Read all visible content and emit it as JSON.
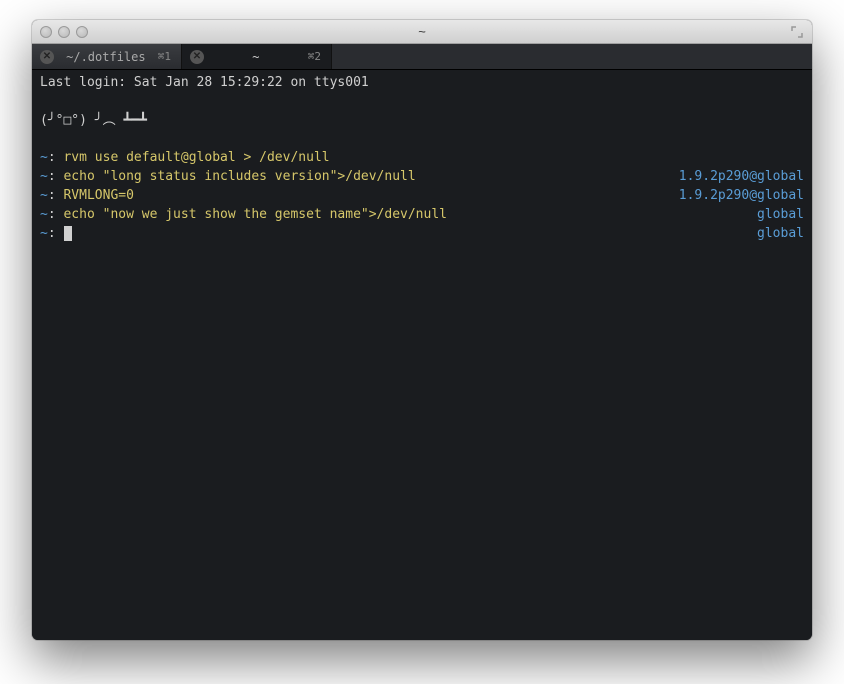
{
  "window": {
    "title": "~"
  },
  "tabs": [
    {
      "label": "~/.dotfiles",
      "shortcut": "⌘1"
    },
    {
      "label": "~",
      "shortcut": "⌘2"
    }
  ],
  "terminal": {
    "last_login": "Last login: Sat Jan 28 15:29:22 on ttys001",
    "art": "(╯°□°) ╯︵ ┻━┻",
    "prompt_dir": "~",
    "prompt_sep": ":",
    "lines": [
      {
        "cmd": "rvm use default@global > /dev/null",
        "status": ""
      },
      {
        "cmd": "echo \"long status includes version\">/dev/null",
        "status": "1.9.2p290@global"
      },
      {
        "cmd": "RVMLONG=0",
        "status": "1.9.2p290@global"
      },
      {
        "cmd": "echo \"now we just show the gemset name\">/dev/null",
        "status": "global"
      },
      {
        "cmd": "",
        "status": "global",
        "cursor": true
      }
    ]
  }
}
